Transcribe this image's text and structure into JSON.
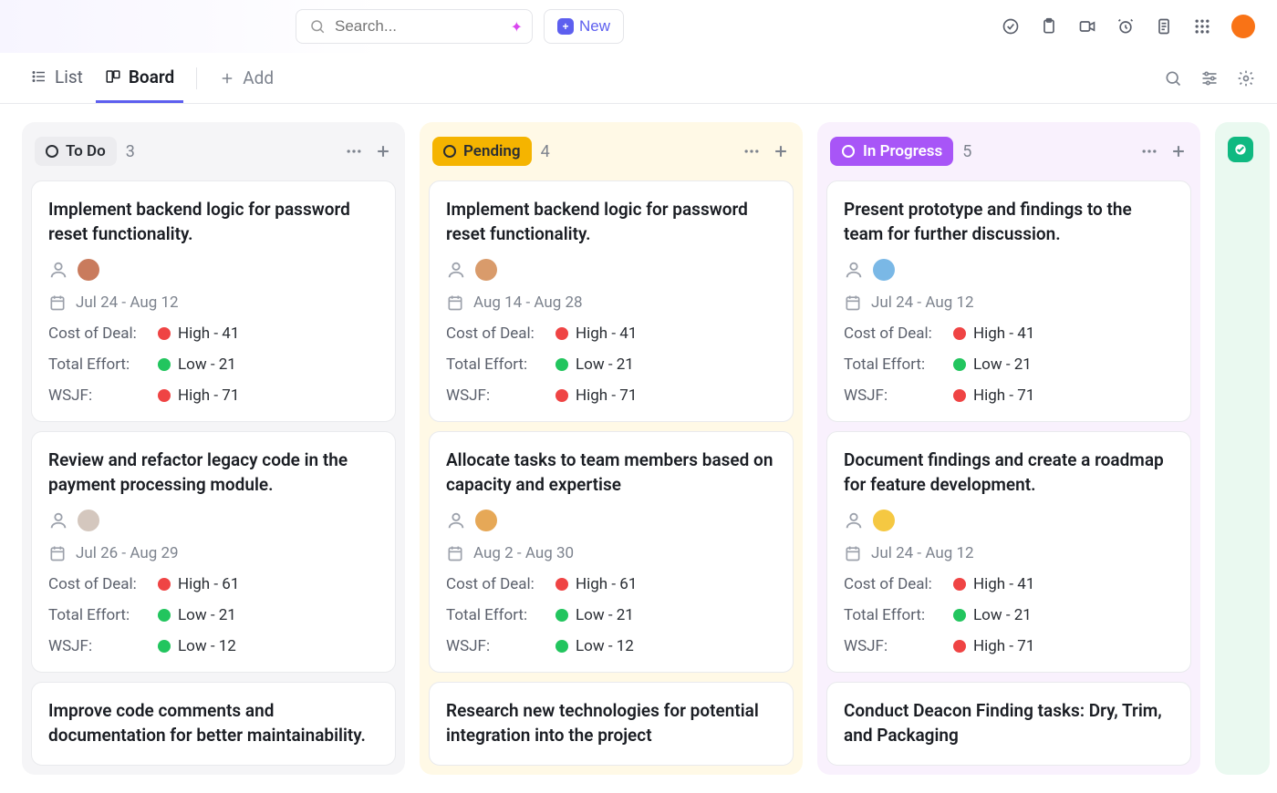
{
  "search": {
    "placeholder": "Search..."
  },
  "new_button_label": "New",
  "views": {
    "list_label": "List",
    "board_label": "Board",
    "add_label": "Add"
  },
  "metric_labels": {
    "cost": "Cost of Deal:",
    "effort": "Total Effort:",
    "wsjf": "WSJF:"
  },
  "columns": [
    {
      "id": "todo",
      "label": "To Do",
      "count": "3",
      "cards": [
        {
          "title": "Implement backend logic for password reset functionality.",
          "avatar_color": "#c97b5d",
          "date": "Jul 24 - Aug 12",
          "cost": {
            "level": "high",
            "text": "High - 41"
          },
          "effort": {
            "level": "low",
            "text": "Low - 21"
          },
          "wsjf": {
            "level": "high",
            "text": "High - 71"
          }
        },
        {
          "title": "Review and refactor legacy code in the payment processing module.",
          "avatar_color": "#d4c7be",
          "date": "Jul 26 - Aug 29",
          "cost": {
            "level": "high",
            "text": "High - 61"
          },
          "effort": {
            "level": "low",
            "text": "Low - 21"
          },
          "wsjf": {
            "level": "low",
            "text": "Low - 12"
          }
        },
        {
          "title": "Improve code comments and documentation for better maintainability.",
          "partial": true
        }
      ]
    },
    {
      "id": "pending",
      "label": "Pending",
      "count": "4",
      "cards": [
        {
          "title": "Implement backend logic for password reset functionality.",
          "avatar_color": "#d99b6b",
          "date": "Aug 14 - Aug 28",
          "cost": {
            "level": "high",
            "text": "High - 41"
          },
          "effort": {
            "level": "low",
            "text": "Low - 21"
          },
          "wsjf": {
            "level": "high",
            "text": "High - 71"
          }
        },
        {
          "title": "Allocate tasks to team members based on capacity and expertise",
          "avatar_color": "#e6a857",
          "date": "Aug 2 - Aug 30",
          "cost": {
            "level": "high",
            "text": "High - 61"
          },
          "effort": {
            "level": "low",
            "text": "Low - 21"
          },
          "wsjf": {
            "level": "low",
            "text": "Low - 12"
          }
        },
        {
          "title": "Research new technologies for potential integration into the project",
          "partial": true
        }
      ]
    },
    {
      "id": "progress",
      "label": "In Progress",
      "count": "5",
      "cards": [
        {
          "title": "Present prototype and findings to the team for further discussion.",
          "avatar_color": "#7ab8e6",
          "date": "Jul 24 - Aug 12",
          "cost": {
            "level": "high",
            "text": "High - 41"
          },
          "effort": {
            "level": "low",
            "text": "Low - 21"
          },
          "wsjf": {
            "level": "high",
            "text": "High - 71"
          }
        },
        {
          "title": "Document findings and create a roadmap for feature development.",
          "avatar_color": "#f5c842",
          "date": "Jul 24 - Aug 12",
          "cost": {
            "level": "high",
            "text": "High - 41"
          },
          "effort": {
            "level": "low",
            "text": "Low - 21"
          },
          "wsjf": {
            "level": "high",
            "text": "High - 71"
          }
        },
        {
          "title": "Conduct Deacon Finding tasks: Dry, Trim, and Packaging",
          "partial": true
        }
      ]
    }
  ]
}
